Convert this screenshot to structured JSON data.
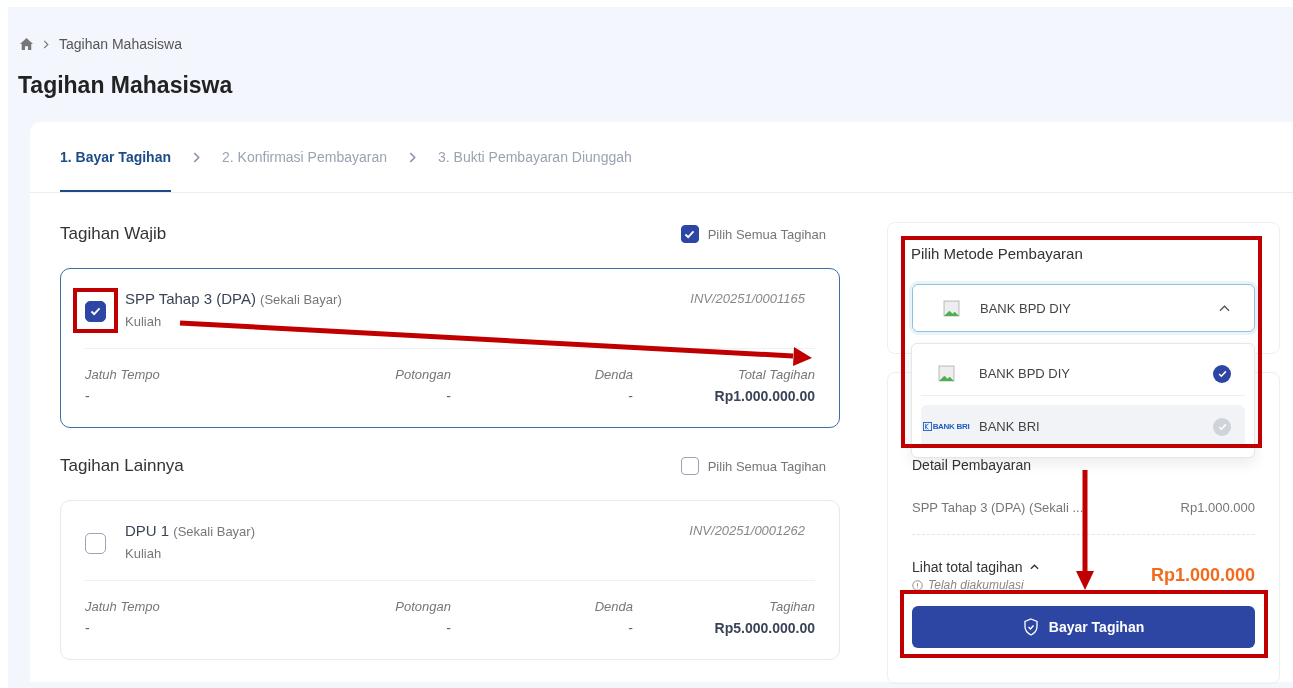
{
  "breadcrumb": {
    "items": [
      "Tagihan Mahasiswa"
    ]
  },
  "title": "Tagihan Mahasiswa",
  "steps": [
    {
      "label": "1. Bayar Tagihan",
      "selected": true
    },
    {
      "label": "2. Konfirmasi Pembayaran",
      "selected": false
    },
    {
      "label": "3. Bukti Pembayaran Diunggah",
      "selected": false
    }
  ],
  "sections": [
    {
      "title": "Tagihan Wajib",
      "select_all": {
        "label": "Pilih Semua Tagihan",
        "checked": true
      },
      "bills": [
        {
          "name": "SPP Tahap 3 (DPA)",
          "note": "(Sekali Bayar)",
          "category": "Kuliah",
          "invoice": "INV/20251/0001165",
          "checked": true,
          "fields": [
            {
              "label": "Jatuh Tempo",
              "value": "-"
            },
            {
              "label": "Potongan",
              "value": "-"
            },
            {
              "label": "Denda",
              "value": "-"
            },
            {
              "label": "Total Tagihan",
              "value": "Rp1.000.000.00"
            }
          ]
        }
      ]
    },
    {
      "title": "Tagihan Lainnya",
      "select_all": {
        "label": "Pilih Semua Tagihan",
        "checked": false
      },
      "bills": [
        {
          "name": "DPU 1",
          "note": "(Sekali Bayar)",
          "category": "Kuliah",
          "invoice": "INV/20251/0001262",
          "checked": false,
          "fields": [
            {
              "label": "Jatuh Tempo",
              "value": "-"
            },
            {
              "label": "Potongan",
              "value": "-"
            },
            {
              "label": "Denda",
              "value": "-"
            },
            {
              "label": "Tagihan",
              "value": "Rp5.000.000.00"
            }
          ]
        }
      ]
    }
  ],
  "payment": {
    "title": "Pilih Metode Pembayaran",
    "select": {
      "value": "BANK BPD DIY",
      "expanded": true
    },
    "options": [
      {
        "name": "BANK BPD DIY",
        "kind": "placeholder",
        "selected": true
      },
      {
        "name": "BANK BRI",
        "kind": "logo",
        "logo_text": "BANK BRI",
        "selected": false
      }
    ],
    "detail": {
      "title": "Detail Pembayaran",
      "items": [
        {
          "label": "SPP Tahap 3 (DPA) (Sekali ...",
          "amount": "Rp1.000.000"
        }
      ]
    },
    "total": {
      "toggle_label": "Lihat total tagihan",
      "expanded": true,
      "note": "Telah diakumulasi",
      "amount": "Rp1.000.000"
    },
    "button": "Bayar Tagihan"
  }
}
